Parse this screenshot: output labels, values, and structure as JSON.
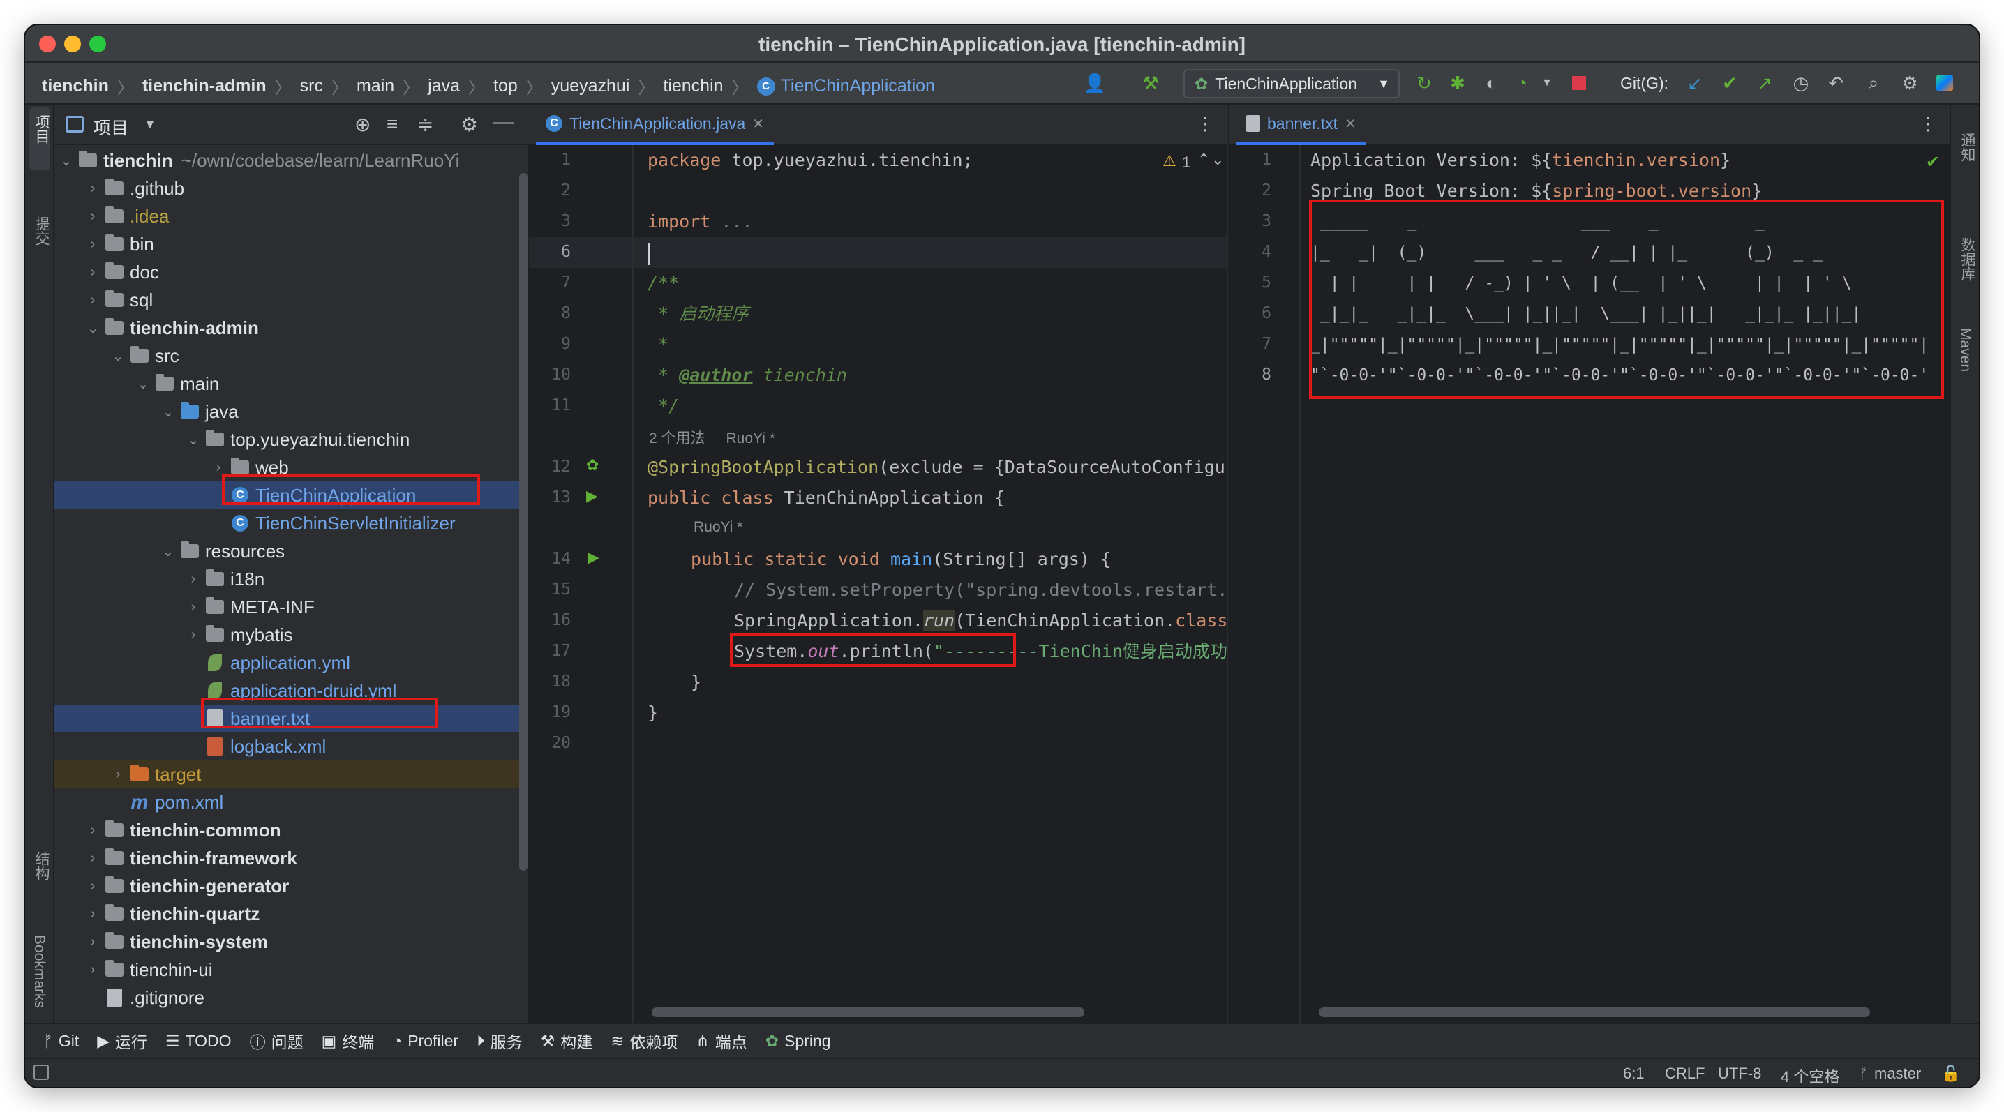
{
  "window": {
    "title": "tienchin – TienChinApplication.java [tienchin-admin]"
  },
  "breadcrumbs": [
    "tienchin",
    "tienchin-admin",
    "src",
    "main",
    "java",
    "top",
    "yueyazhui",
    "tienchin",
    "TienChinApplication"
  ],
  "toolbar": {
    "run_config": "TienChinApplication",
    "git_label": "Git(G):"
  },
  "left_strip": {
    "project": "项目",
    "commit": "提交",
    "structure": "结构",
    "bookmarks": "Bookmarks"
  },
  "right_strip": {
    "notifications": "通知",
    "database": "数据库",
    "maven": "Maven"
  },
  "project_panel": {
    "title": "项目",
    "root_name": "tienchin",
    "root_path": "~/own/codebase/learn/LearnRuoYi",
    "items": [
      {
        "label": "tienchin",
        "type": "root"
      },
      {
        "label": ".github"
      },
      {
        "label": ".idea"
      },
      {
        "label": "bin"
      },
      {
        "label": "doc"
      },
      {
        "label": "sql"
      },
      {
        "label": "tienchin-admin"
      },
      {
        "label": "src"
      },
      {
        "label": "main"
      },
      {
        "label": "java"
      },
      {
        "label": "top.yueyazhui.tienchin"
      },
      {
        "label": "web"
      },
      {
        "label": "TienChinApplication"
      },
      {
        "label": "TienChinServletInitializer"
      },
      {
        "label": "resources"
      },
      {
        "label": "i18n"
      },
      {
        "label": "META-INF"
      },
      {
        "label": "mybatis"
      },
      {
        "label": "application.yml"
      },
      {
        "label": "application-druid.yml"
      },
      {
        "label": "banner.txt"
      },
      {
        "label": "logback.xml"
      },
      {
        "label": "target"
      },
      {
        "label": "pom.xml"
      },
      {
        "label": "tienchin-common"
      },
      {
        "label": "tienchin-framework"
      },
      {
        "label": "tienchin-generator"
      },
      {
        "label": "tienchin-quartz"
      },
      {
        "label": "tienchin-system"
      },
      {
        "label": "tienchin-ui"
      },
      {
        "label": ".gitignore"
      }
    ]
  },
  "editor_left": {
    "tab": "TienChinApplication.java",
    "warning_count": "1",
    "line_numbers": [
      "1",
      "2",
      "3",
      "6",
      "7",
      "8",
      "9",
      "10",
      "11",
      "12",
      "13",
      "14",
      "15",
      "16",
      "17",
      "18",
      "19",
      "20"
    ],
    "inlay_usages": "2 个用法",
    "inlay_author1": "RuoYi *",
    "inlay_author2": "RuoYi *",
    "code": {
      "l1_kw": "package",
      "l1_rest": " top.yueyazhui.tienchin;",
      "l3_kw": "import",
      "l3_rest": " ...",
      "l7": "/**",
      "l8": " * 启动程序",
      "l9": " *",
      "l10_a": " * ",
      "l10_tag": "@author",
      "l10_b": " tienchin",
      "l11": " */",
      "l12_ann": "@SpringBootApplication",
      "l12_rest": "(exclude = {DataSourceAutoConfigur",
      "l13_kw": "public class",
      "l13_rest": " TienChinApplication {",
      "l14_kw": "public static void",
      "l14_fn": " main",
      "l14_rest": "(String[] args) {",
      "l15": "// System.setProperty(\"spring.devtools.restart.e",
      "l16_a": "SpringApplication.",
      "l16_fn": "run",
      "l16_b": "(TienChinApplication.",
      "l16_kw": "class",
      "l17_a": "System.",
      "l17_fld": "out",
      "l17_b": ".println(",
      "l17_str": "\"---------TienChin健身启动成功",
      "l18": "}",
      "l19": "}"
    }
  },
  "editor_right": {
    "tab": "banner.txt",
    "line_numbers": [
      "1",
      "2",
      "3",
      "4",
      "5",
      "6",
      "7",
      "8"
    ],
    "lines": [
      {
        "a": "Application Version: ${",
        "b": "tienchin.version",
        "c": "}"
      },
      {
        "a": "Spring Boot Version: ${",
        "b": "spring-boot.version",
        "c": "}"
      },
      {
        "a": " _____    _                 ___    _          _"
      },
      {
        "a": "|_   _|  (_)     ___   _ _   / __| | |_      (_)  _ _"
      },
      {
        "a": "  | |     | |   / -_) | ' \\  | (__  | ' \\     | |  | ' \\"
      },
      {
        "a": " _|_|_   _|_|_  \\___| |_||_|  \\___| |_||_|   _|_|_ |_||_|"
      },
      {
        "a": "_|\"\"\"\"\"|_|\"\"\"\"\"|_|\"\"\"\"\"|_|\"\"\"\"\"|_|\"\"\"\"\"|_|\"\"\"\"\"|_|\"\"\"\"\"|_|\"\"\"\"\"|"
      },
      {
        "a": "\"`-0-0-'\"`-0-0-'\"`-0-0-'\"`-0-0-'\"`-0-0-'\"`-0-0-'\"`-0-0-'\"`-0-0-'"
      }
    ]
  },
  "bottom_tools": [
    "Git",
    "运行",
    "TODO",
    "问题",
    "终端",
    "Profiler",
    "服务",
    "构建",
    "依赖项",
    "端点",
    "Spring"
  ],
  "status": {
    "position": "6:1",
    "line_sep": "CRLF",
    "encoding": "UTF-8",
    "indent": "4 个空格",
    "branch": "master"
  },
  "colors": {
    "accent": "#3574f0",
    "highlight_box": "#e01818",
    "selection": "#2e436e"
  }
}
